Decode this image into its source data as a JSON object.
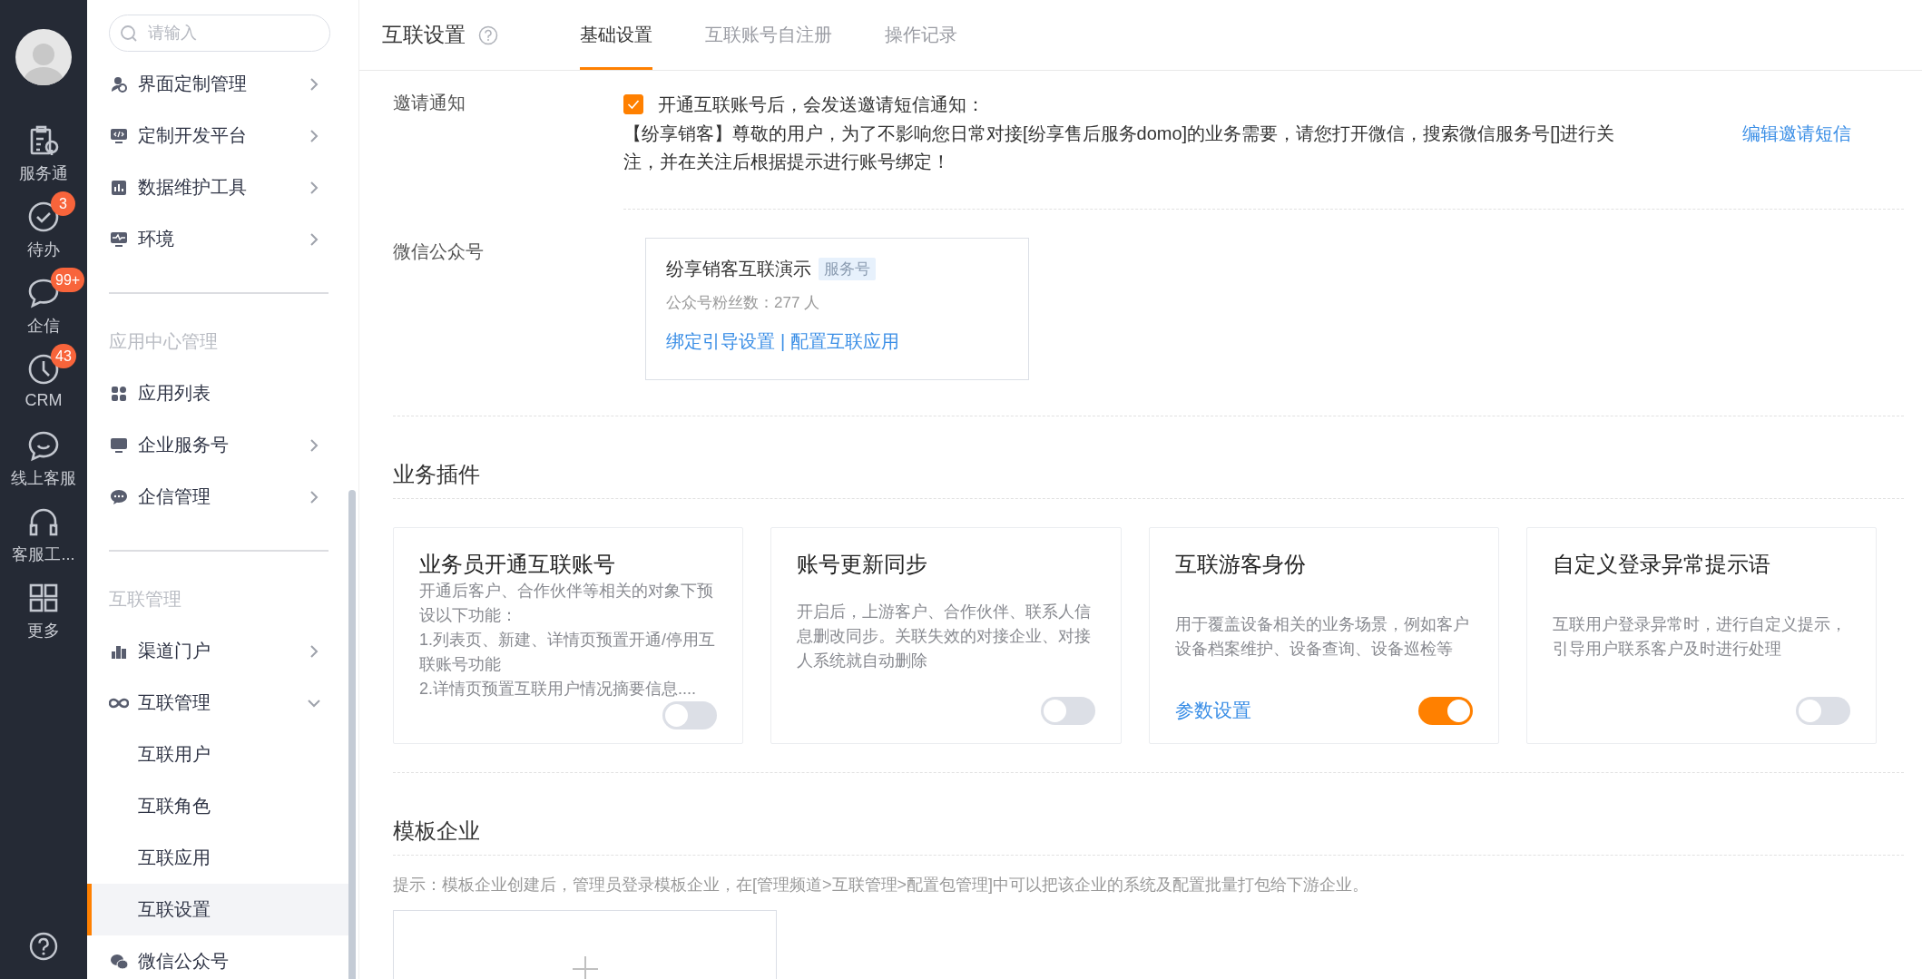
{
  "rail": {
    "items": [
      {
        "label": "服务通"
      },
      {
        "label": "待办",
        "badge": "3"
      },
      {
        "label": "企信",
        "badge": "99+"
      },
      {
        "label": "CRM",
        "badge": "43"
      },
      {
        "label": "线上客服"
      },
      {
        "label": "客服工..."
      },
      {
        "label": "更多"
      }
    ]
  },
  "sidebar": {
    "search": {
      "placeholder": "请输入"
    },
    "groups": [
      {
        "items": [
          {
            "label": "界面定制管理",
            "kind": "folder",
            "expanded": false,
            "selected": false
          },
          {
            "label": "定制开发平台",
            "kind": "folder",
            "expanded": false,
            "selected": false
          },
          {
            "label": "数据维护工具",
            "kind": "folder",
            "expanded": false,
            "selected": false
          },
          {
            "label": "环境",
            "kind": "folder",
            "expanded": false,
            "selected": false
          }
        ]
      },
      {
        "title": "应用中心管理",
        "items": [
          {
            "label": "应用列表",
            "kind": "page",
            "selected": false
          },
          {
            "label": "企业服务号",
            "kind": "folder",
            "expanded": false,
            "selected": false
          },
          {
            "label": "企信管理",
            "kind": "folder",
            "expanded": false,
            "selected": false
          }
        ]
      },
      {
        "title": "互联管理",
        "items": [
          {
            "label": "渠道门户",
            "kind": "folder",
            "expanded": false,
            "selected": false
          },
          {
            "label": "互联管理",
            "kind": "folder",
            "expanded": true,
            "selected": false,
            "children": [
              {
                "label": "互联用户",
                "selected": false
              },
              {
                "label": "互联角色",
                "selected": false
              },
              {
                "label": "互联应用",
                "selected": false
              },
              {
                "label": "互联设置",
                "selected": true
              }
            ]
          },
          {
            "label": "微信公众号",
            "kind": "page",
            "selected": false
          }
        ]
      }
    ]
  },
  "header": {
    "title": "互联设置",
    "tabs": [
      {
        "label": "基础设置",
        "selected": true
      },
      {
        "label": "互联账号自注册",
        "selected": false
      },
      {
        "label": "操作记录",
        "selected": false
      }
    ]
  },
  "invite": {
    "label": "邀请通知",
    "checkbox": {
      "label": "开通互联账号后，会发送邀请短信通知：",
      "checked": true
    },
    "message": "【纷享销客】尊敬的用户，为了不影响您日常对接[纷享售后服务domo]的业务需要，请您打开微信，搜索微信服务号[]进行关注，并在关注后根据提示进行账号绑定！",
    "edit_link": "编辑邀请短信"
  },
  "wechat": {
    "label": "微信公众号",
    "account": {
      "name": "纷享销客互联演示",
      "tag": "服务号",
      "fans": "公众号粉丝数：277 人",
      "links": [
        "绑定引导设置",
        "配置互联应用"
      ],
      "separator": "|"
    }
  },
  "plugins": {
    "title": "业务插件",
    "cards": [
      {
        "title": "业务员开通互联账号",
        "desc": [
          "开通后客户、合作伙伴等相关的对象下预设以下功能：",
          "1.列表页、新建、详情页预置开通/停用互联账号功能",
          "2.详情页预置互联用户情况摘要信息...."
        ],
        "on": false
      },
      {
        "title": "账号更新同步",
        "desc": [
          "开启后，上游客户、合作伙伴、联系人信息删改同步。关联失效的对接企业、对接人系统就自动删除"
        ],
        "on": false
      },
      {
        "title": "互联游客身份",
        "desc": [
          "用于覆盖设备相关的业务场景，例如客户设备档案维护、设备查询、设备巡检等"
        ],
        "link": "参数设置",
        "on": true
      },
      {
        "title": "自定义登录异常提示语",
        "desc": [
          "互联用户登录异常时，进行自定义提示，引导用户联系客户及时进行处理"
        ],
        "on": false
      }
    ]
  },
  "template": {
    "title": "模板企业",
    "hint": "提示：模板企业创建后，管理员登录模板企业，在[管理频道>互联管理>配置包管理]中可以把该企业的系统及配置批量打包给下游企业。"
  }
}
